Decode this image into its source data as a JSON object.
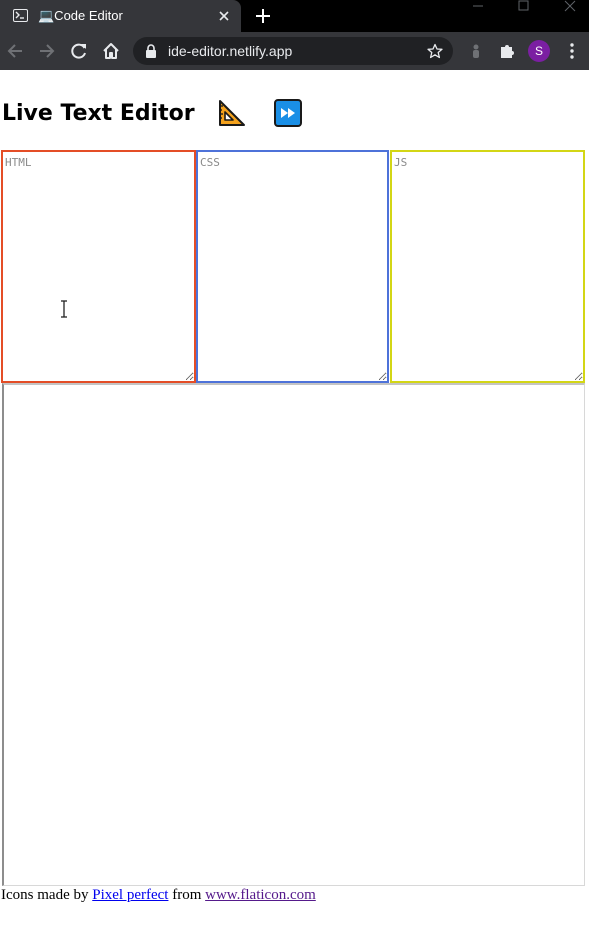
{
  "browser": {
    "tab_title": "💻Code Editor",
    "url": "ide-editor.netlify.app",
    "profile_initial": "S"
  },
  "page": {
    "title": "Live Text Editor",
    "icons": [
      "triangular-ruler-icon",
      "fast-forward-icon"
    ],
    "editors": {
      "html_placeholder": "HTML",
      "css_placeholder": "CSS",
      "js_placeholder": "JS"
    },
    "attribution": {
      "prefix": "Icons made by",
      "author_link": "Pixel perfect",
      "middle": "from",
      "site_link": "www.flaticon.com"
    }
  },
  "colors": {
    "html_border": "#e44d26",
    "css_border": "#4e72d9",
    "js_border": "#d3d615",
    "link": "#0000ee",
    "visited_link": "#551a8b"
  }
}
